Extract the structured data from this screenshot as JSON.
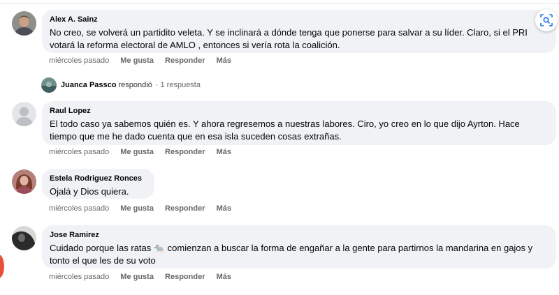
{
  "comments": [
    {
      "author": "Alex A. Sainz",
      "text": "No creo, se volverá un partidito veleta. Y se inclinará a dónde tenga que ponerse para salvar a su líder. Claro, si el PRI votará la reforma electoral de AMLO , entonces si vería rota la coalición.",
      "time": "miércoles pasado",
      "like": "Me gusta",
      "reply": "Responder",
      "more": "Más"
    },
    {
      "author": "Raul Lopez",
      "text": "El todo caso ya sabemos quién es. Y ahora regresemos a nuestras labores. Ciro, yo creo en lo que dijo Ayrton. Hace tiempo que me he dado cuenta que en esa isla suceden cosas extrañas.",
      "time": "miércoles pasado",
      "like": "Me gusta",
      "reply": "Responder",
      "more": "Más"
    },
    {
      "author": "Estela Rodriguez Ronces",
      "text": "Ojalá y Dios quiera.",
      "time": "miércoles pasado",
      "like": "Me gusta",
      "reply": "Responder",
      "more": "Más"
    },
    {
      "author": "Jose Ramirez",
      "text": "Cuidado porque las ratas 🐀 comienzan a buscar la forma de engañar a la gente para partirnos la mandarina en gajos y tonto el que les de su voto",
      "time": "miércoles pasado",
      "like": "Me gusta",
      "reply": "Responder",
      "more": "Más"
    }
  ],
  "reply_summary": {
    "name": "Juanca Passco",
    "verb": "respondió",
    "separator": "·",
    "count": "1 respuesta"
  },
  "icons": {
    "lens": "visual-search-icon"
  },
  "colors": {
    "bubble": "#f0f2f5",
    "meta_text": "#65676b",
    "edge_dot": "#e8503a"
  }
}
